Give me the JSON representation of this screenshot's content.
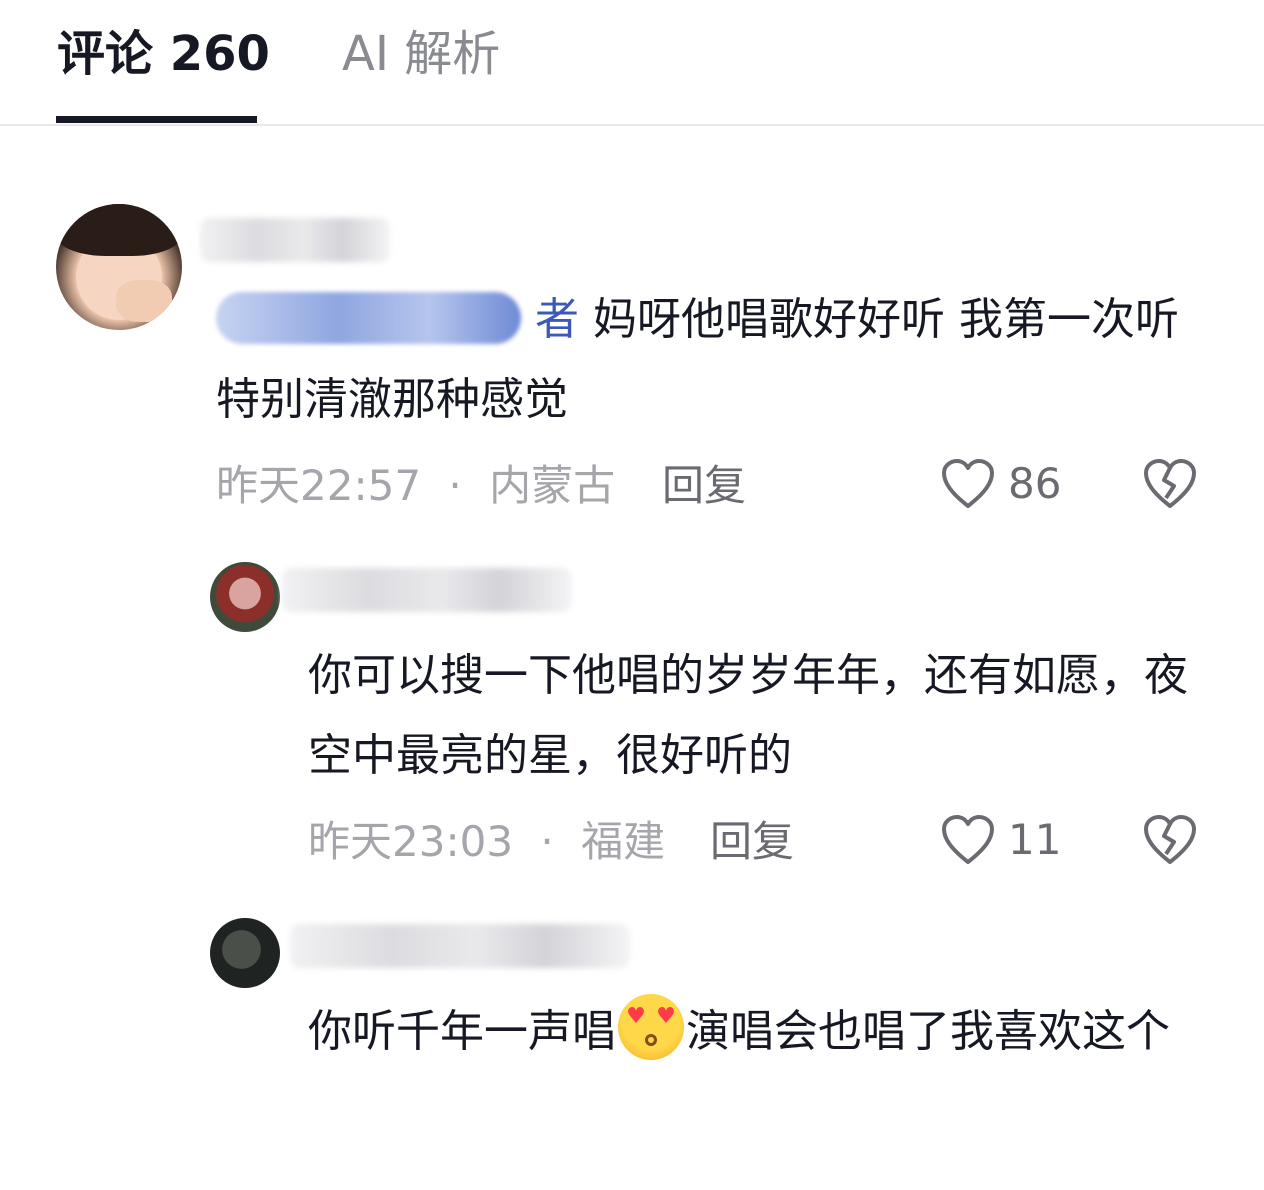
{
  "tabs": {
    "comments_label": "评论 260",
    "ai_label": "AI 解析"
  },
  "comments": [
    {
      "mention_tail": "者",
      "text": "妈呀他唱歌好好听 我第一次听 特别清澈那种感觉",
      "time": "昨天22:57",
      "location": "内蒙古",
      "reply_label": "回复",
      "likes": "86"
    },
    {
      "text": "你可以搜一下他唱的岁岁年年，还有如愿，夜空中最亮的星，很好听的",
      "time": "昨天23:03",
      "location": "福建",
      "reply_label": "回复",
      "likes": "11"
    },
    {
      "text_before": "你听千年一声唱",
      "emoji": "heart-eyes-kiss-emoji",
      "text_after": "演唱会也唱了我喜欢这个"
    }
  ],
  "separator": "·",
  "colors": {
    "text": "#161823",
    "muted": "#a5a6ab",
    "mention": "#3c59b8",
    "tab_underline": "#161823"
  },
  "icons": {
    "like": "heart-outline-icon",
    "dislike": "broken-heart-icon"
  }
}
